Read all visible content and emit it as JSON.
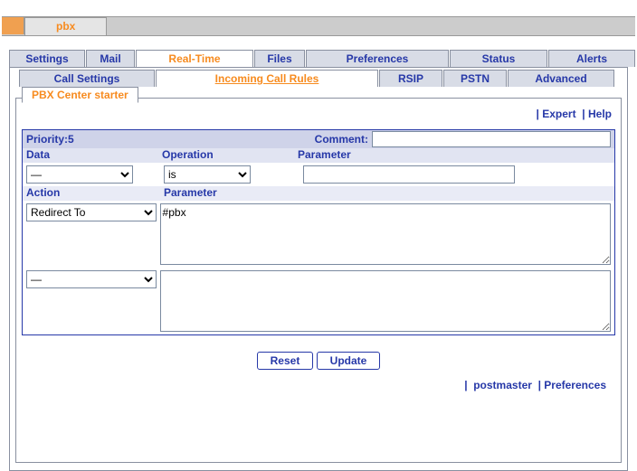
{
  "top_tab": "pbx",
  "nav1": {
    "items": [
      {
        "label": "Settings"
      },
      {
        "label": "Mail"
      },
      {
        "label": "Real-Time",
        "active": true
      },
      {
        "label": "Files"
      },
      {
        "label": "Preferences"
      },
      {
        "label": "Status"
      },
      {
        "label": "Alerts"
      }
    ]
  },
  "nav2": {
    "items": [
      {
        "label": "Call Settings"
      },
      {
        "label": "Incoming Call Rules",
        "active": true
      },
      {
        "label": "RSIP"
      },
      {
        "label": "PSTN"
      },
      {
        "label": "Advanced"
      }
    ]
  },
  "panel_title": "PBX Center starter",
  "toolbar": {
    "expert": "Expert",
    "help": "Help"
  },
  "form": {
    "priority_label": "Priority:",
    "priority_value": "5",
    "comment_label": "Comment:",
    "comment_value": "",
    "headers": {
      "data": "Data",
      "operation": "Operation",
      "parameter": "Parameter",
      "action": "Action",
      "parameter2": "Parameter"
    },
    "data_select": "—",
    "operation_select": "is",
    "parameter_value": "",
    "action_select": "Redirect To",
    "action_parameter": "#pbx",
    "action2_select": "—",
    "action2_parameter": ""
  },
  "buttons": {
    "reset": "Reset",
    "update": "Update"
  },
  "footer": {
    "postmaster": "postmaster",
    "preferences": "Preferences"
  }
}
